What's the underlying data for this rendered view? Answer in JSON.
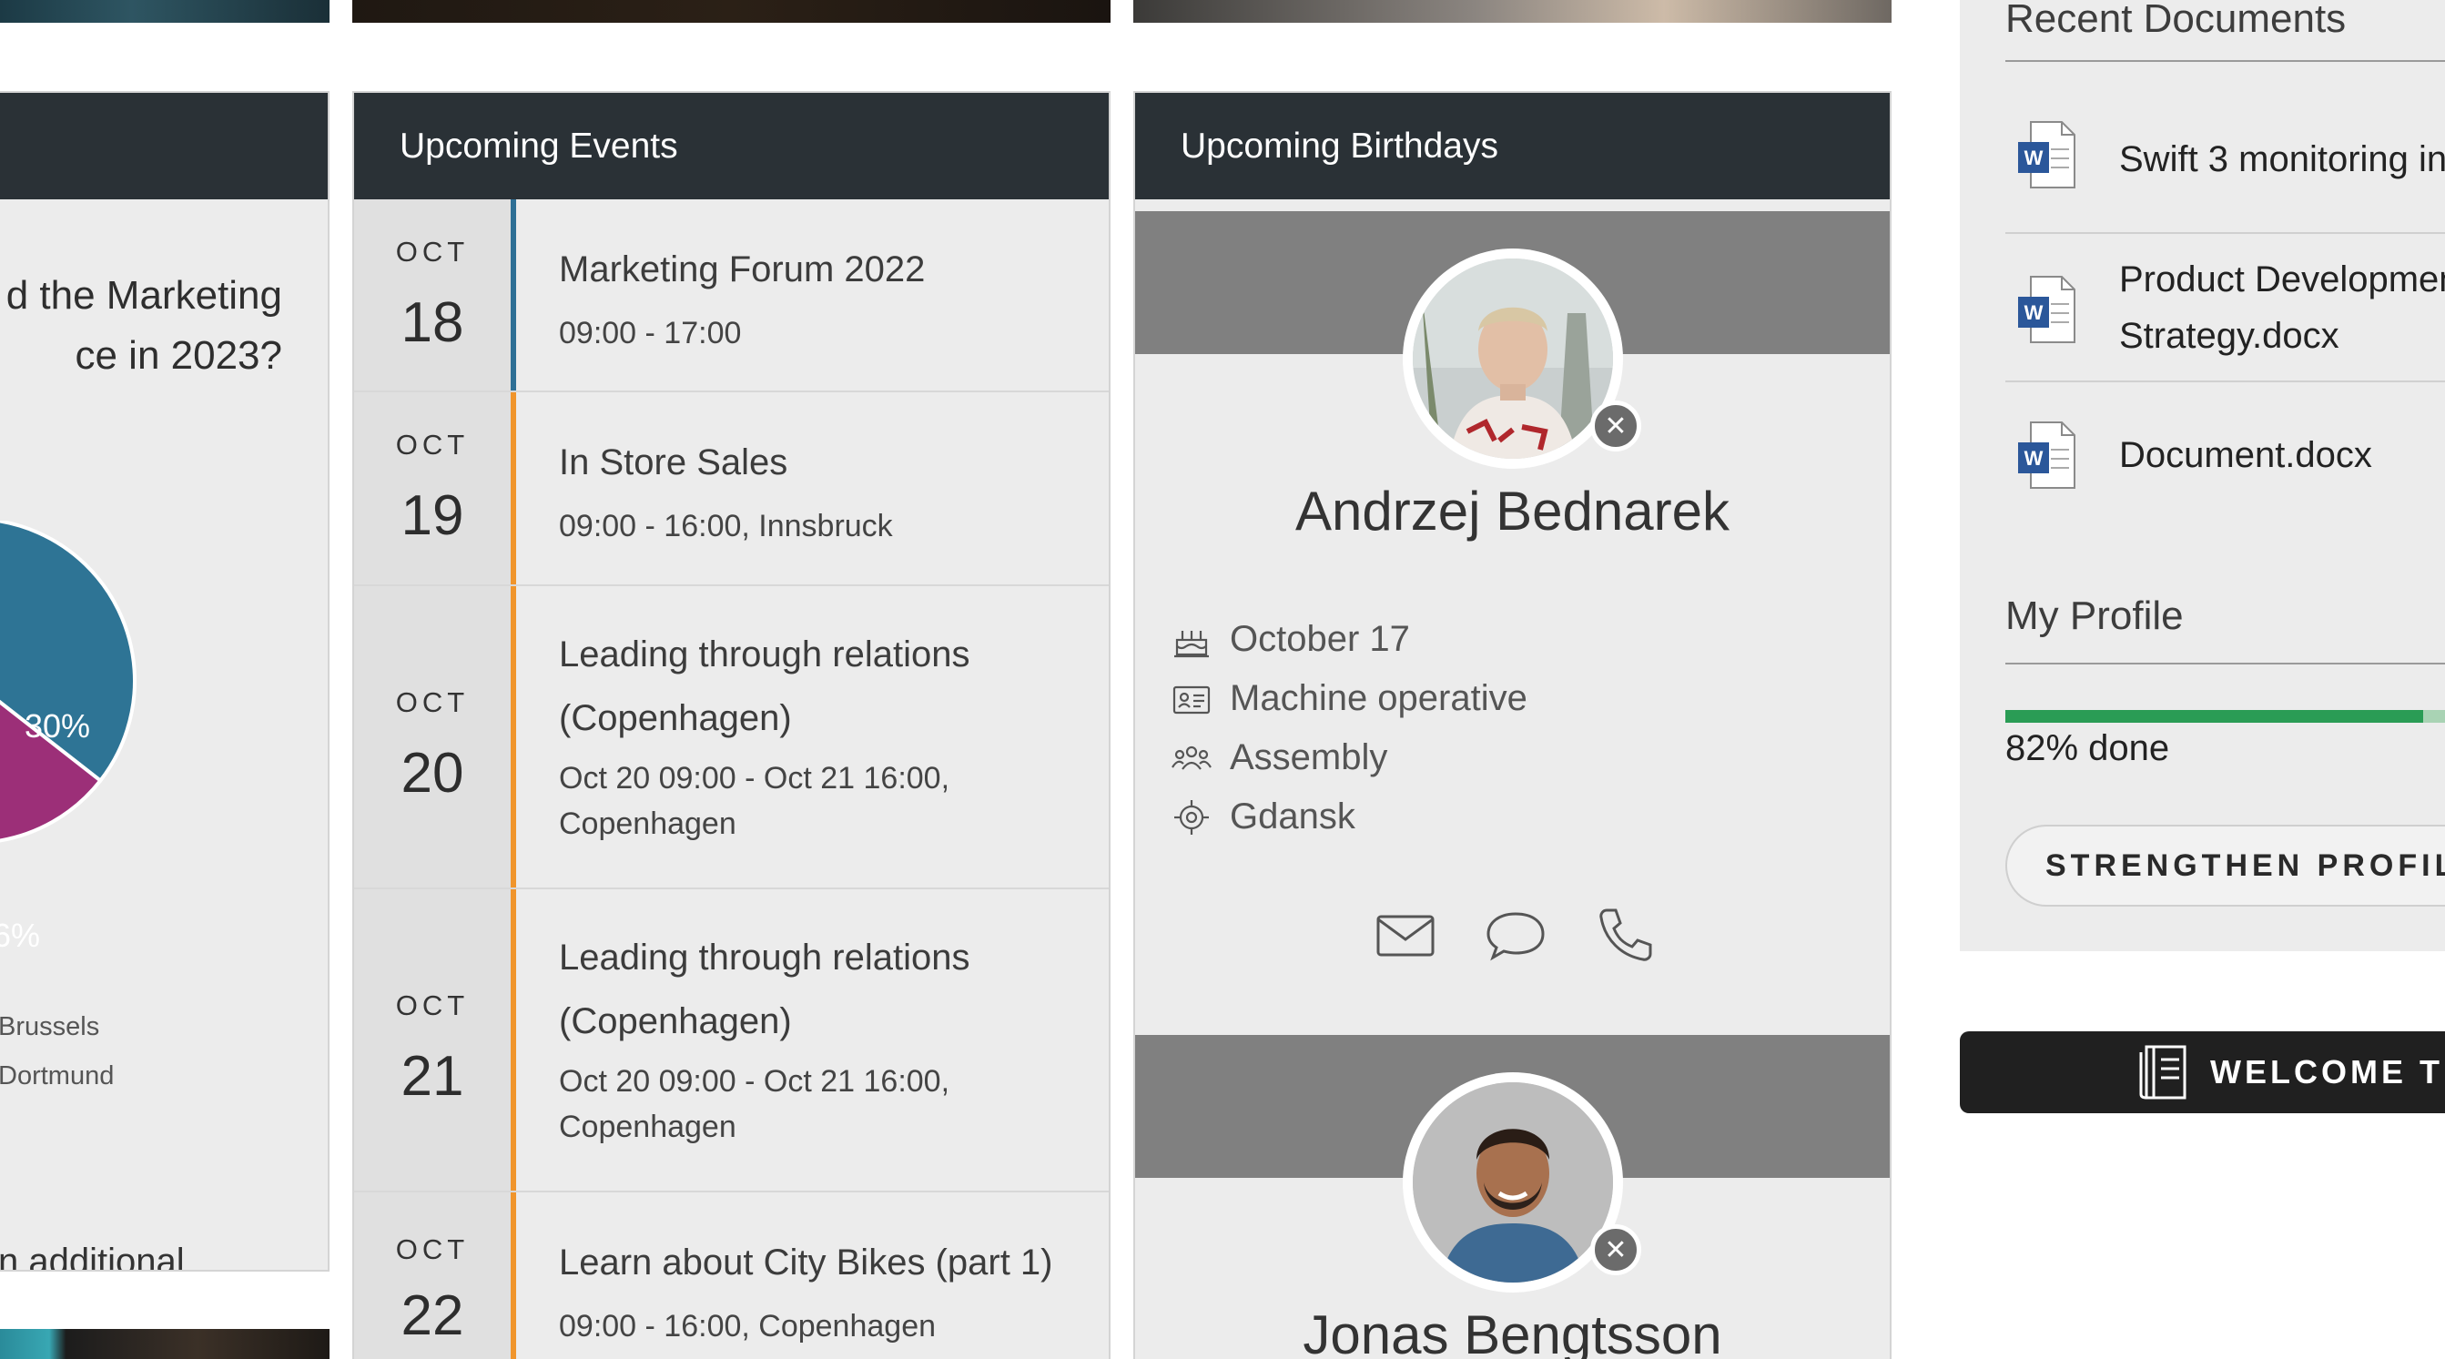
{
  "poll": {
    "question_line1": "d the Marketing",
    "question_line2": "ce in 2023?",
    "slices": [
      {
        "label": "30%",
        "value": 30,
        "color": "#2e7495"
      },
      {
        "label": "6%",
        "value": 26,
        "color": "#9c2f78"
      }
    ],
    "legend": [
      "Brussels",
      "Dortmund"
    ],
    "footer": "n additional"
  },
  "events": {
    "title": "Upcoming Events",
    "items": [
      {
        "month": "OCT",
        "day": "18",
        "title": "Marketing Forum 2022",
        "time": "09:00 - 17:00"
      },
      {
        "month": "OCT",
        "day": "19",
        "title": "In Store Sales",
        "time": "09:00 - 16:00, Innsbruck"
      },
      {
        "month": "OCT",
        "day": "20",
        "title_line1": "Leading through relations",
        "title_line2": "(Copenhagen)",
        "time_line1": "Oct 20 09:00 - Oct 21 16:00,",
        "time_line2": "Copenhagen"
      },
      {
        "month": "OCT",
        "day": "21",
        "title_line1": "Leading through relations",
        "title_line2": "(Copenhagen)",
        "time_line1": "Oct 20 09:00 - Oct 21 16:00,",
        "time_line2": "Copenhagen"
      },
      {
        "month": "OCT",
        "day": "22",
        "title": "Learn about City Bikes (part 1)",
        "time": "09:00 - 16:00, Copenhagen"
      }
    ]
  },
  "birthdays": {
    "title": "Upcoming Birthdays",
    "people": [
      {
        "name": "Andrzej Bednarek",
        "birthday": "October 17",
        "role": "Machine operative",
        "department": "Assembly",
        "location": "Gdansk"
      },
      {
        "name": "Jonas Bengtsson"
      }
    ],
    "remove_symbol": "✕"
  },
  "side": {
    "recent_docs_title": "Recent Documents",
    "documents": [
      {
        "name_line1": "Swift 3 monitoring in"
      },
      {
        "name_line1": "Product Developmen",
        "name_line2": "Strategy.docx"
      },
      {
        "name_line1": "Document.docx"
      }
    ],
    "doc_icon_letter": "W",
    "profile_title": "My Profile",
    "profile_progress": 0.82,
    "progress_label": "82% done",
    "strengthen_label": "STRENGTHEN PROFILE",
    "welcome_label": "WELCOME TUT"
  },
  "colors": {
    "header_bg": "#2a3136",
    "event_accent_first": "#2e6f95",
    "event_accent": "#f0952c",
    "progress": "#2a9c55",
    "word_blue": "#2b579a"
  }
}
